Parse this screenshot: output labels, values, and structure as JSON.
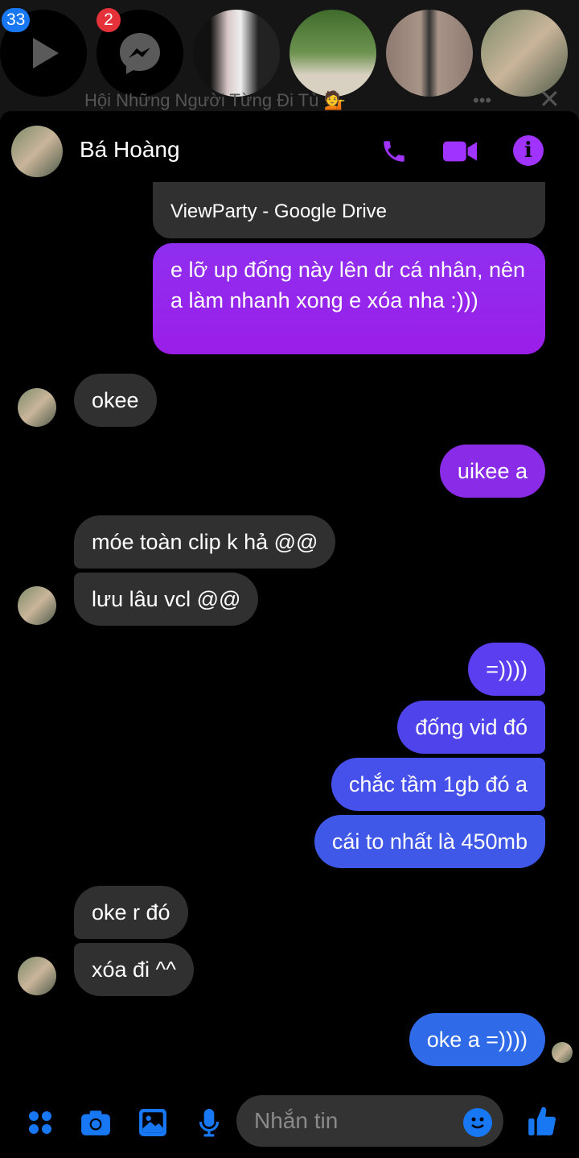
{
  "chatheads": {
    "watch_badge": "33",
    "messenger_badge": "2",
    "group_name": "Hội Những Người Từng Đi Tù 💁"
  },
  "header": {
    "contact_name": "Bá Hoàng"
  },
  "messages": [
    {
      "from": "me",
      "text": "ViewParty - Google Drive"
    },
    {
      "from": "me",
      "text": "e lỡ up đống này lên dr cá nhân, nên a làm nhanh xong e xóa nha :)))"
    },
    {
      "from": "them",
      "text": "okee"
    },
    {
      "from": "me",
      "text": "uikee a"
    },
    {
      "from": "them",
      "text": "móe toàn clip k hả @@"
    },
    {
      "from": "them",
      "text": "lưu lâu vcl @@"
    },
    {
      "from": "me",
      "text": "=))))"
    },
    {
      "from": "me",
      "text": "đống vid đó"
    },
    {
      "from": "me",
      "text": "chắc tầm 1gb đó a"
    },
    {
      "from": "me",
      "text": "cái to nhất là 450mb"
    },
    {
      "from": "them",
      "text": "oke r đó"
    },
    {
      "from": "them",
      "text": "xóa đi ^^"
    },
    {
      "from": "me",
      "text": "oke a =))))"
    }
  ],
  "composer": {
    "placeholder": "Nhắn tin"
  },
  "colors": {
    "accent_purple": "#a033ff",
    "accent_blue": "#1877f2",
    "bubble_gray": "#303030"
  }
}
